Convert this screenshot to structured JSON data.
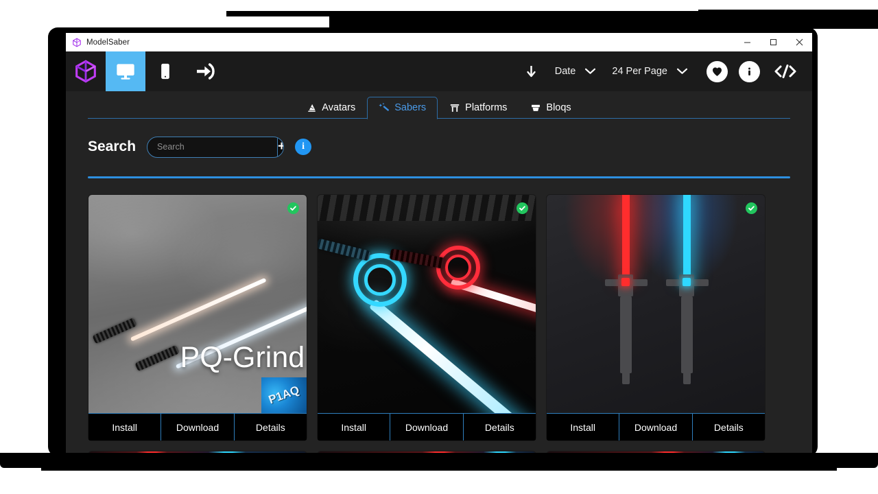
{
  "window": {
    "title": "ModelSaber",
    "logo_icon": "cube-logo-icon",
    "controls": {
      "minimize": "minimize-icon",
      "maximize": "maximize-icon",
      "close": "close-icon"
    }
  },
  "toolbar": {
    "left_items": [
      {
        "name": "brand-cube",
        "icon": "cube-logo-icon",
        "active": false
      },
      {
        "name": "desktop-mode",
        "icon": "monitor-icon",
        "active": true
      },
      {
        "name": "mobile-mode",
        "icon": "phone-icon",
        "active": false
      },
      {
        "name": "login",
        "icon": "login-arrow-icon",
        "active": false
      }
    ],
    "sort_direction_icon": "arrow-down-icon",
    "sort_by": "Date",
    "per_page": "24 Per Page",
    "favorites_icon": "heart-icon",
    "info_icon": "info-icon",
    "code_icon": "code-brackets-icon",
    "accent_active": "#55b9f3",
    "background": "#1b1b1b"
  },
  "tabs": [
    {
      "label": "Avatars",
      "icon": "avatar-hat-icon",
      "active": false
    },
    {
      "label": "Sabers",
      "icon": "magic-wand-icon",
      "active": true
    },
    {
      "label": "Platforms",
      "icon": "torii-gate-icon",
      "active": false
    },
    {
      "label": "Bloqs",
      "icon": "block-box-icon",
      "active": false
    }
  ],
  "search": {
    "label": "Search",
    "placeholder": "Search",
    "value": "",
    "add_button": "+",
    "info_button": "i",
    "divider_color": "#2d8fe0"
  },
  "cards": [
    {
      "title": "PQ-Grind",
      "author_badge": "P1AQ",
      "verified": true,
      "art": "grind",
      "actions": [
        "Install",
        "Download",
        "Details"
      ]
    },
    {
      "title": "",
      "author_badge": "",
      "verified": true,
      "art": "lattice",
      "actions": [
        "Install",
        "Download",
        "Details"
      ]
    },
    {
      "title": "",
      "author_badge": "",
      "verified": true,
      "art": "cross",
      "actions": [
        "Install",
        "Download",
        "Details"
      ]
    }
  ],
  "second_row_peek": {
    "visible": true,
    "card_count": 3,
    "accent_red": "#ff2d2d",
    "accent_cyan": "#2fd8ff"
  },
  "colors": {
    "page_background": "#ffffff",
    "window_frame": "#000000",
    "app_background": "#232323",
    "toolbar_background": "#1b1b1b",
    "accent_blue": "#2d8fe0",
    "tab_active_text": "#4a9ae8",
    "verified_green": "#22c55e",
    "logo_purple": "#b03cf0"
  }
}
